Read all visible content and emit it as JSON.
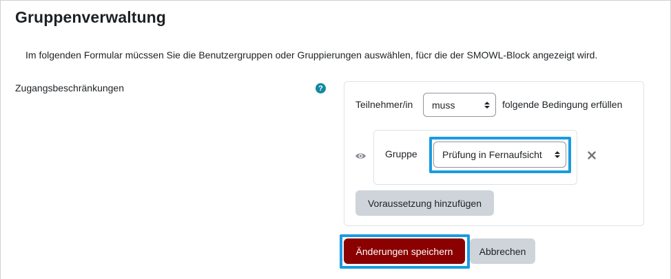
{
  "page": {
    "title": "Gruppenverwaltung",
    "intro": "Im folgenden Formular mücssen Sie die Benutzergruppen oder Gruppierungen auswählen, fücr die der SMOWL-Block angezeigt wird."
  },
  "restrictions": {
    "label": "Zugangsbeschränkungen",
    "help_icon_glyph": "?",
    "condition_prefix": "Teilnehmer/in",
    "condition_select": "muss",
    "condition_suffix": "folgende Bedingung erfüllen",
    "group_label": "Gruppe",
    "group_select": "Prüfung in Fernaufsicht",
    "add_button": "Voraussetzung hinzufügen",
    "eye_icon": "eye-icon",
    "delete_icon": "close-icon"
  },
  "actions": {
    "save": "Änderungen speichern",
    "cancel": "Abbrechen"
  },
  "colors": {
    "primary": "#8b0000",
    "secondary": "#ced4da",
    "highlight": "#1a9be0",
    "help": "#138aa0"
  }
}
